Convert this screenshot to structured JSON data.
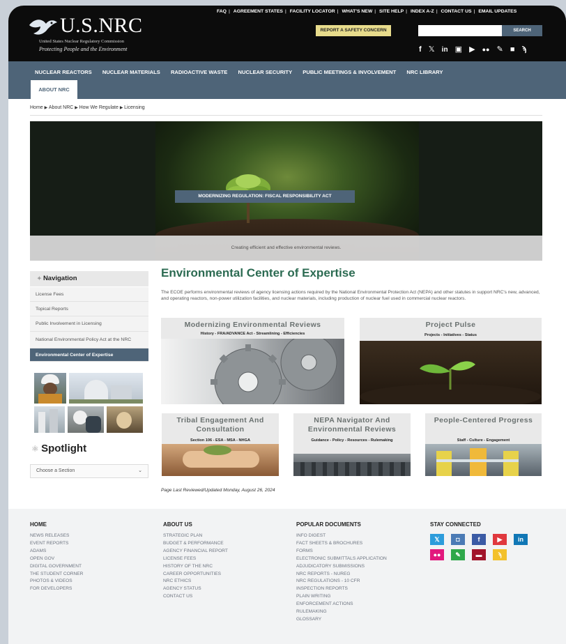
{
  "header": {
    "logo_text": "U.S.NRC",
    "logo_subtitle": "United States Nuclear Regulatory Commission",
    "logo_tagline": "Protecting People and the Environment",
    "utility_links": [
      "FAQ",
      "AGREEMENT STATES",
      "FACILITY LOCATOR",
      "WHAT'S NEW",
      "SITE HELP",
      "INDEX A-Z",
      "CONTACT US",
      "EMAIL UPDATES"
    ],
    "report_button": "REPORT A SAFETY CONCERN",
    "search_placeholder": "",
    "search_button": "SEARCH",
    "social_icons": [
      "facebook-icon",
      "x-icon",
      "linkedin-icon",
      "instagram-icon",
      "youtube-icon",
      "flickr-icon",
      "pen-icon",
      "comment-icon",
      "rss-icon"
    ]
  },
  "nav": {
    "items": [
      "NUCLEAR REACTORS",
      "NUCLEAR MATERIALS",
      "RADIOACTIVE WASTE",
      "NUCLEAR SECURITY",
      "PUBLIC MEETINGS & INVOLVEMENT",
      "NRC LIBRARY"
    ],
    "active": "ABOUT NRC"
  },
  "breadcrumb": [
    "Home",
    "About NRC",
    "How We Regulate",
    "Licensing"
  ],
  "hero": {
    "caption": "MODERNIZING REGULATION: FISCAL RESPONSIBILITY ACT",
    "bar_text": "Creating efficient and effective environmental reviews."
  },
  "sidebar": {
    "heading": "Navigation",
    "items": [
      "License Fees",
      "Topical Reports",
      "Public Involvement in Licensing",
      "National Environmental Policy Act at the NRC",
      "Environmental Center of Expertise"
    ],
    "spotlight_heading": "Spotlight",
    "spotlight_select": "Choose a Section"
  },
  "main": {
    "title": "Environmental Center of Expertise",
    "intro": "The ECOE performs environmental reviews of agency licensing actions required by the National Environmental Protection Act (NEPA) and other statutes in support NRC's new, advanced, and operating reactors, non-power utilization facilities, and nuclear materials, including production of nuclear fuel used in commercial nuclear reactors.",
    "cards": [
      {
        "title": "Modernizing Environmental Reviews",
        "subtitle": "History - FRA/ADVANCE Act - Streamlining - Efficiencies"
      },
      {
        "title": "Project Pulse",
        "subtitle": "Projects - Initiatives - Status"
      },
      {
        "title": "Tribal Engagement And Consultation",
        "subtitle": "Section 106 - ESA - MSA - NHGA"
      },
      {
        "title": "NEPA Navigator And Environmental Reviews",
        "subtitle": "Guidance - Policy - Resources - Rulemaking"
      },
      {
        "title": "People-Centered Progress",
        "subtitle": "Staff - Culture - Engagement"
      }
    ],
    "updated": "Page Last Reviewed/Updated Monday, August 26, 2024"
  },
  "footer": {
    "home": {
      "heading": "HOME",
      "links": [
        "NEWS RELEASES",
        "EVENT REPORTS",
        "ADAMS",
        "OPEN GOV",
        "DIGITAL GOVERNMENT",
        "THE STUDENT CORNER",
        "PHOTOS & VIDEOS",
        "FOR DEVELOPERS"
      ]
    },
    "about": {
      "heading": "ABOUT US",
      "links": [
        "STRATEGIC PLAN",
        "BUDGET & PERFORMANCE",
        "AGENCY FINANCIAL REPORT",
        "LICENSE FEES",
        "HISTORY OF THE NRC",
        "CAREER OPPORTUNITIES",
        "NRC ETHICS",
        "AGENCY STATUS",
        "CONTACT US"
      ]
    },
    "docs": {
      "heading": "POPULAR DOCUMENTS",
      "links": [
        "INFO DIGEST",
        "FACT SHEETS & BROCHURES",
        "FORMS",
        "ELECTRONIC SUBMITTALS APPLICATION",
        "ADJUDICATORY SUBMISSIONS",
        "NRC REPORTS - NUREG",
        "NRC REGULATIONS - 10 CFR",
        "INSPECTION REPORTS",
        "PLAIN WRITING",
        "ENFORCEMENT ACTIONS",
        "RULEMAKING",
        "GLOSSARY"
      ]
    },
    "connect": {
      "heading": "STAY CONNECTED"
    }
  },
  "colors": {
    "header_bg": "#0c0c0c",
    "nav_bg": "#4e6478",
    "accent_green": "#2c6b52",
    "report_yellow": "#e8dc8c"
  }
}
